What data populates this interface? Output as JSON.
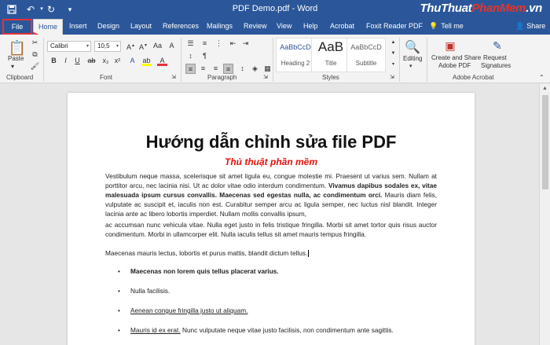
{
  "window": {
    "title": "PDF Demo.pdf  -  Word"
  },
  "watermark": {
    "part1": "ThuThuat",
    "part2": "PhanMem",
    "part3": ".vn"
  },
  "tabs": [
    {
      "label": "File"
    },
    {
      "label": "Home"
    },
    {
      "label": "Insert"
    },
    {
      "label": "Design"
    },
    {
      "label": "Layout"
    },
    {
      "label": "References"
    },
    {
      "label": "Mailings"
    },
    {
      "label": "Review"
    },
    {
      "label": "View"
    },
    {
      "label": "Help"
    },
    {
      "label": "Acrobat"
    },
    {
      "label": "Foxit Reader PDF"
    },
    {
      "label": "Tell me"
    },
    {
      "label": "Share"
    }
  ],
  "ribbon": {
    "clipboard": {
      "label": "Clipboard",
      "paste": "Paste"
    },
    "font": {
      "label": "Font",
      "font_name": "Calibri",
      "font_size": "10,5"
    },
    "paragraph": {
      "label": "Paragraph"
    },
    "styles": {
      "label": "Styles",
      "items": [
        {
          "sample": "AaBbCcD",
          "name": "Heading 2"
        },
        {
          "sample": "AaB",
          "name": "Title"
        },
        {
          "sample": "AaBbCcD",
          "name": "Subtitle"
        }
      ]
    },
    "editing": {
      "label": "Editing"
    },
    "acrobat": {
      "label": "Adobe Acrobat",
      "create_line1": "Create and Share",
      "create_line2": "Adobe PDF",
      "request_line1": "Request",
      "request_line2": "Signatures"
    }
  },
  "document": {
    "title": "Hướng dẫn chỉnh sửa file PDF",
    "subtitle": "Thủ thuật phần mềm",
    "p1": {
      "a": "Vestibulum neque massa, scelerisque sit amet ligula eu, congue molestie mi. Praesent ut varius sem. Nullam at porttitor arcu, nec lacinia nisi. Ut ac dolor vitae odio interdum condimentum. ",
      "b": "Vivamus dapibus sodales ex, vitae malesuada ipsum cursus convallis. Maecenas sed egestas nulla, ac condimentum orci.",
      "c": " Mauris diam felis, vulputate ac suscipit et, iaculis non est. Curabitur semper arcu ac ligula semper, nec luctus nisl blandit. Integer lacinia ante ac libero lobortis imperdiet. Nullam mollis convallis ipsum,",
      "d": "ac accumsan nunc vehicula vitae. Nulla eget justo in felis tristique fringilla. Morbi sit amet tortor quis risus auctor condimentum. Morbi in ullamcorper elit. Nulla iaculis tellus sit amet mauris tempus fringilla."
    },
    "p2": "Maecenas mauris lectus, lobortis et purus mattis, blandit dictum tellus.",
    "bullets": [
      {
        "text": "Maecenas non lorem quis tellus placerat varius."
      },
      {
        "text": "Nulla facilisis."
      },
      {
        "text": "Aenean congue fringilla justo ut aliquam."
      },
      {
        "text_u": "Mauris id ex erat.",
        "text_rest": " Nunc vulputate neque vitae justo facilisis, non condimentum ante sagittis."
      }
    ]
  }
}
